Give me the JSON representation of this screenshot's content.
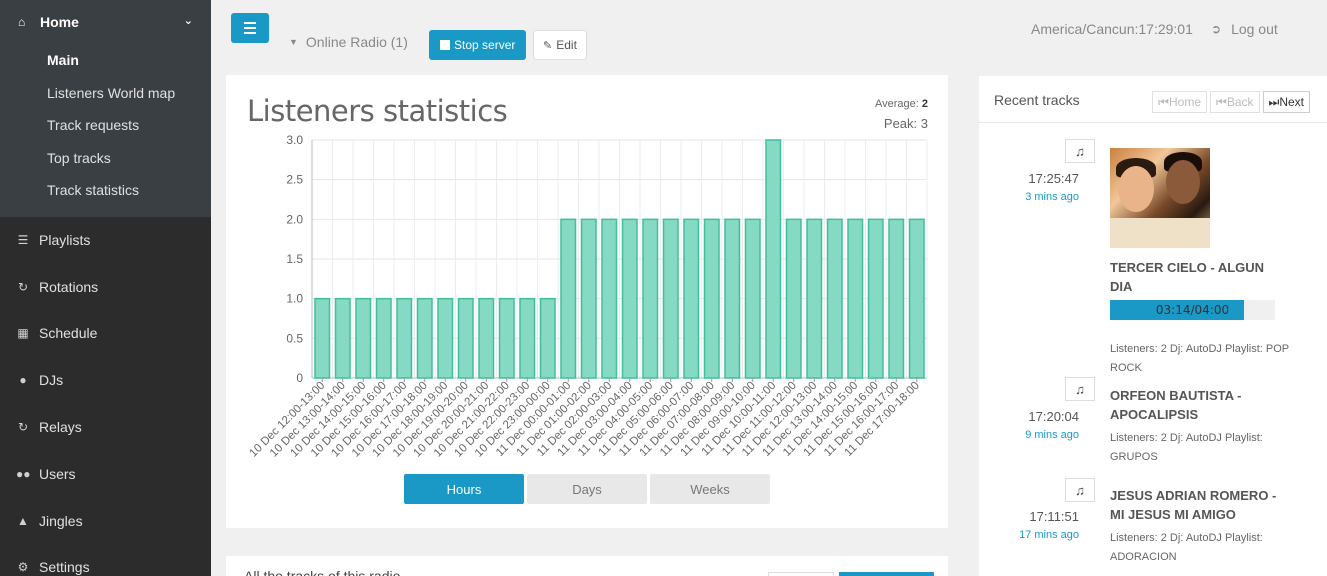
{
  "sidebar": {
    "home_label": "Home",
    "sub_items": [
      {
        "label": "Main",
        "active": true
      },
      {
        "label": "Listeners World map",
        "active": false
      },
      {
        "label": "Track requests",
        "active": false
      },
      {
        "label": "Top tracks",
        "active": false
      },
      {
        "label": "Track statistics",
        "active": false
      }
    ],
    "items": [
      {
        "label": "Playlists",
        "icon": "list-icon"
      },
      {
        "label": "Rotations",
        "icon": "refresh-icon"
      },
      {
        "label": "Schedule",
        "icon": "calendar-icon"
      },
      {
        "label": "DJs",
        "icon": "user-icon"
      },
      {
        "label": "Relays",
        "icon": "redo-icon"
      },
      {
        "label": "Users",
        "icon": "users-icon"
      },
      {
        "label": "Jingles",
        "icon": "bell-icon"
      },
      {
        "label": "Settings",
        "icon": "cogs-icon"
      }
    ]
  },
  "header": {
    "radio_label": "Online Radio (1)",
    "stop_label": "Stop server",
    "edit_label": "Edit",
    "clock": "America/Cancun:17:29:01",
    "logout_label": "Log out"
  },
  "stats": {
    "title": "Listeners statistics",
    "average_label": "Average:",
    "average_value": "2",
    "peak_text": "Peak: 3",
    "ranges": [
      {
        "label": "Hours",
        "active": true
      },
      {
        "label": "Days",
        "active": false
      },
      {
        "label": "Weeks",
        "active": false
      }
    ]
  },
  "below": {
    "title": "All the tracks of this radio"
  },
  "recent": {
    "title": "Recent tracks",
    "home_label": "Home",
    "back_label": "Back",
    "next_label": "Next",
    "tracks": [
      {
        "time": "17:25:47",
        "ago": "3 mins ago",
        "title": "TERCER CIELO - ALGUN DIA",
        "progress_text": "03:14/04:00",
        "progress": 0.81,
        "meta": "Listeners: 2 Dj: AutoDJ Playlist: POP ROCK"
      },
      {
        "time": "17:20:04",
        "ago": "9 mins ago",
        "title": "ORFEON BAUTISTA - APOCALIPSIS",
        "meta": "Listeners: 2 Dj: AutoDJ Playlist: GRUPOS"
      },
      {
        "time": "17:11:51",
        "ago": "17 mins ago",
        "title": "JESUS ADRIAN ROMERO - MI JESUS MI AMIGO",
        "meta": "Listeners: 2 Dj: AutoDJ Playlist: ADORACION"
      }
    ]
  },
  "colors": {
    "accent": "#1a98c6",
    "bar_fill": "#86d9c3",
    "bar_stroke": "#3fbf9c"
  },
  "chart_data": {
    "type": "bar",
    "categories": [
      "10 Dec 12:00-13:00",
      "10 Dec 13:00-14:00",
      "10 Dec 14:00-15:00",
      "10 Dec 15:00-16:00",
      "10 Dec 16:00-17:00",
      "10 Dec 17:00-18:00",
      "10 Dec 18:00-19:00",
      "10 Dec 19:00-20:00",
      "10 Dec 20:00-21:00",
      "10 Dec 21:00-22:00",
      "10 Dec 22:00-23:00",
      "10 Dec 23:00-00:00",
      "11 Dec 00:00-01:00",
      "11 Dec 01:00-02:00",
      "11 Dec 02:00-03:00",
      "11 Dec 03:00-04:00",
      "11 Dec 04:00-05:00",
      "11 Dec 05:00-06:00",
      "11 Dec 06:00-07:00",
      "11 Dec 07:00-08:00",
      "11 Dec 08:00-09:00",
      "11 Dec 09:00-10:00",
      "11 Dec 10:00-11:00",
      "11 Dec 11:00-12:00",
      "11 Dec 12:00-13:00",
      "11 Dec 13:00-14:00",
      "11 Dec 14:00-15:00",
      "11 Dec 15:00-16:00",
      "11 Dec 16:00-17:00",
      "11 Dec 17:00-18:00"
    ],
    "values": [
      1,
      1,
      1,
      1,
      1,
      1,
      1,
      1,
      1,
      1,
      1,
      1,
      2,
      2,
      2,
      2,
      2,
      2,
      2,
      2,
      2,
      2,
      3,
      2,
      2,
      2,
      2,
      2,
      2,
      2
    ],
    "ylim": [
      0,
      3
    ],
    "yticks": [
      "0",
      "0.5",
      "1.0",
      "1.5",
      "2.0",
      "2.5",
      "3.0"
    ],
    "grid": true
  }
}
